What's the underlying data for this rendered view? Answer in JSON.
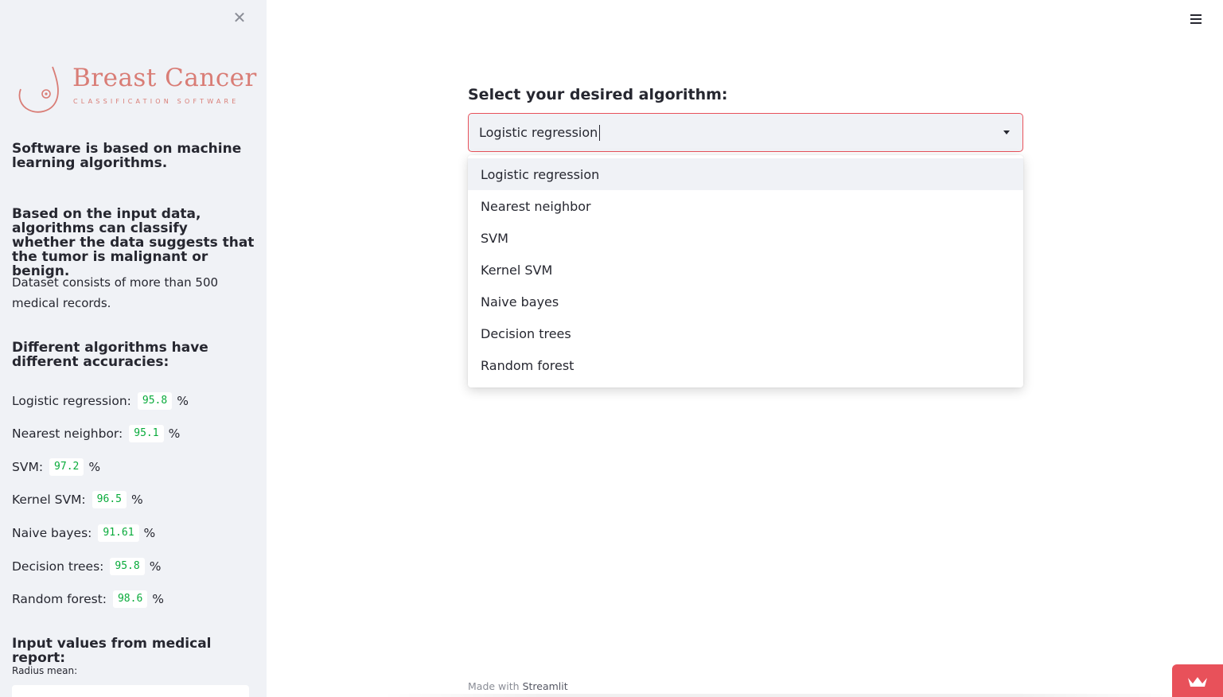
{
  "sidebar": {
    "close_glyph": "✕",
    "logo": {
      "title": "Breast Cancer",
      "subtitle": "CLASSIFICATION SOFTWARE",
      "color": "#d97d76"
    },
    "heading1": "Software is based on machine learning algorithms.",
    "heading2": "Based on the input data, algorithms can classify whether the data suggests that the tumor is malignant or benign.",
    "dataset_text": "Dataset consists of more than 500 medical records.",
    "heading3": "Different algorithms have different accuracies:",
    "accuracies": [
      {
        "label": "Logistic regression:",
        "value": "95.8",
        "unit": "%"
      },
      {
        "label": "Nearest neighbor:",
        "value": "95.1",
        "unit": "%"
      },
      {
        "label": "SVM:",
        "value": "97.2",
        "unit": "%"
      },
      {
        "label": "Kernel SVM:",
        "value": "96.5",
        "unit": "%"
      },
      {
        "label": "Naive bayes:",
        "value": "91.61",
        "unit": "%"
      },
      {
        "label": "Decision trees:",
        "value": "95.8",
        "unit": "%"
      },
      {
        "label": "Random forest:",
        "value": "98.6",
        "unit": "%"
      }
    ],
    "heading4": "Input values from medical report:",
    "radius_label": "Radius mean:"
  },
  "main": {
    "menu_icon": "hamburger-icon",
    "select_label": "Select your desired algorithm:",
    "select_value": "Logistic regression",
    "options": [
      "Logistic regression",
      "Nearest neighbor",
      "SVM",
      "Kernel SVM",
      "Naive bayes",
      "Decision trees",
      "Random forest"
    ],
    "active_option_index": 0,
    "footer_prefix": "Made with",
    "footer_brand": "Streamlit"
  },
  "colors": {
    "accent": "#e8515a",
    "sidebar_bg": "#f0f2f6",
    "accuracy_green": "#09ab3b"
  }
}
